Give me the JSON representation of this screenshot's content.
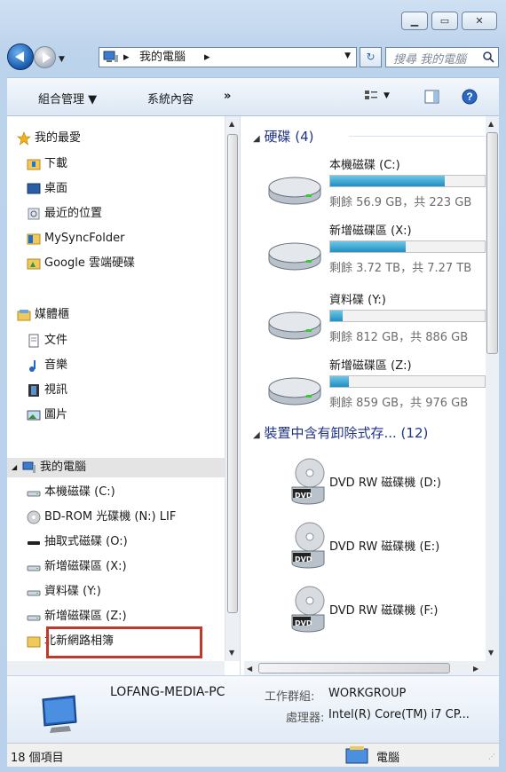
{
  "address": {
    "crumbs": [
      "我的電腦"
    ],
    "search_placeholder": "搜尋 我的電腦"
  },
  "toolbar": {
    "organize": "組合管理 ▼",
    "system_properties": "系統內容",
    "more": "»"
  },
  "nav": {
    "favorites": {
      "header": "我的最愛",
      "items": [
        "下載",
        "桌面",
        "最近的位置",
        "MySyncFolder",
        "Google 雲端硬碟"
      ]
    },
    "libraries": {
      "header": "媒體櫃",
      "items": [
        "文件",
        "音樂",
        "視訊",
        "圖片"
      ]
    },
    "computer": {
      "header": "我的電腦",
      "items": [
        "本機磁碟 (C:)",
        "BD-ROM 光碟機 (N:) LIF",
        "抽取式磁碟 (O:)",
        "新增磁碟區 (X:)",
        "資料碟 (Y:)",
        "新增磁碟區 (Z:)",
        "北新網路相簿"
      ]
    }
  },
  "content": {
    "hdd_header": "硬碟 (4)",
    "drives": [
      {
        "name": "本機磁碟 (C:)",
        "free": "剩餘 56.9 GB，共 223 GB",
        "used_pct": 74
      },
      {
        "name": "新增磁碟區 (X:)",
        "free": "剩餘 3.72 TB，共 7.27 TB",
        "used_pct": 49
      },
      {
        "name": "資料碟 (Y:)",
        "free": "剩餘 812 GB，共 886 GB",
        "used_pct": 8
      },
      {
        "name": "新增磁碟區 (Z:)",
        "free": "剩餘 859 GB，共 976 GB",
        "used_pct": 12
      }
    ],
    "removable_header": "裝置中含有卸除式存... (12)",
    "removable": [
      "DVD RW 磁碟機 (D:)",
      "DVD RW 磁碟機 (E:)",
      "DVD RW 磁碟機 (F:)"
    ],
    "dvd_badge": "DVD"
  },
  "details": {
    "pc_name": "LOFANG-MEDIA-PC",
    "workgroup_label": "工作群組:",
    "workgroup": "WORKGROUP",
    "cpu_label": "處理器:",
    "cpu": "Intel(R) Core(TM) i7 CP..."
  },
  "status": {
    "count": "18 個項目",
    "location": "電腦"
  },
  "colors": {
    "highlight_box": "#c0392b",
    "bar_fill": "#1f8fc2",
    "section_header": "#1e3287"
  }
}
